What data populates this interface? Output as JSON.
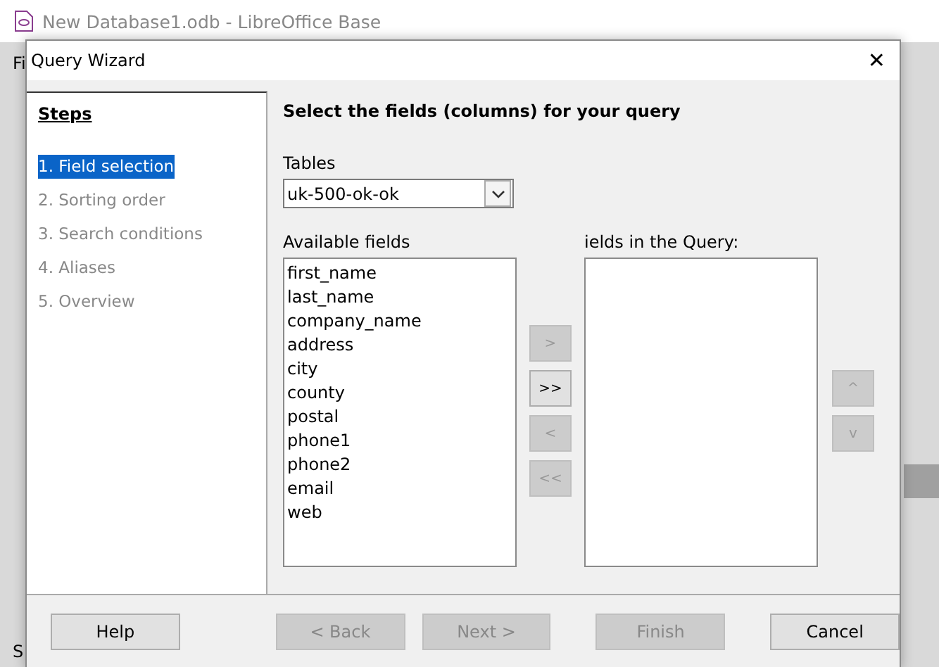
{
  "background_window": {
    "title": "New Database1.odb - LibreOffice Base",
    "menu_fragment": "Fi",
    "status_fragment": "S"
  },
  "dialog": {
    "title": "Query Wizard",
    "close": "✕"
  },
  "steps": {
    "heading": "Steps",
    "items": [
      {
        "label": "1. Field selection",
        "selected": true
      },
      {
        "label": "2. Sorting order",
        "selected": false
      },
      {
        "label": "3. Search conditions",
        "selected": false
      },
      {
        "label": "4. Aliases",
        "selected": false
      },
      {
        "label": "5. Overview",
        "selected": false
      }
    ]
  },
  "page": {
    "heading": "Select the fields (columns) for your query",
    "tables_label": "Tables",
    "table_value": "uk-500-ok-ok",
    "available_label": "Available fields",
    "available_fields": [
      "first_name",
      "last_name",
      "company_name",
      "address",
      "city",
      "county",
      "postal",
      "phone1",
      "phone2",
      "email",
      "web"
    ],
    "query_label": "ields in the Query:",
    "move_buttons": [
      {
        "label": ">",
        "disabled": true
      },
      {
        "label": ">>",
        "disabled": false
      },
      {
        "label": "<",
        "disabled": true
      },
      {
        "label": "<<",
        "disabled": true
      }
    ],
    "order_buttons": [
      {
        "label": "^",
        "disabled": true
      },
      {
        "label": "v",
        "disabled": true
      }
    ]
  },
  "footer_buttons": [
    {
      "label": "Help",
      "disabled": false
    },
    {
      "label": "< Back",
      "disabled": true
    },
    {
      "label": "Next >",
      "disabled": true
    },
    {
      "label": "Finish",
      "disabled": true
    },
    {
      "label": "Cancel",
      "disabled": false
    }
  ]
}
